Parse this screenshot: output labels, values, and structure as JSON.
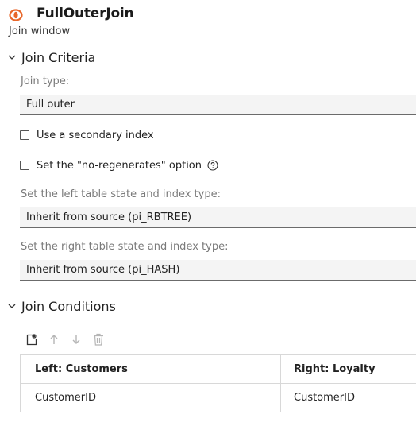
{
  "header": {
    "title": "FullOuterJoin",
    "subtitle": "Join window",
    "icon": "join-window-icon",
    "accent_color": "#e8672a"
  },
  "join_criteria": {
    "section_title": "Join Criteria",
    "join_type": {
      "label": "Join type:",
      "value": "Full outer"
    },
    "secondary_index": {
      "label": "Use a secondary index",
      "checked": false
    },
    "no_regenerates": {
      "label": "Set the \"no-regenerates\" option",
      "checked": false,
      "help_icon": "help-icon"
    },
    "left_index": {
      "label": "Set the left table state and index type:",
      "value": "Inherit from source (pi_RBTREE)"
    },
    "right_index": {
      "label": "Set the right table state and index type:",
      "value": "Inherit from source (pi_HASH)"
    }
  },
  "join_conditions": {
    "section_title": "Join Conditions",
    "toolbar": [
      "add-condition-icon",
      "move-up-icon",
      "move-down-icon",
      "delete-icon"
    ],
    "columns": [
      "Left: Customers",
      "Right: Loyalty"
    ],
    "rows": [
      [
        "CustomerID",
        "CustomerID"
      ]
    ]
  }
}
